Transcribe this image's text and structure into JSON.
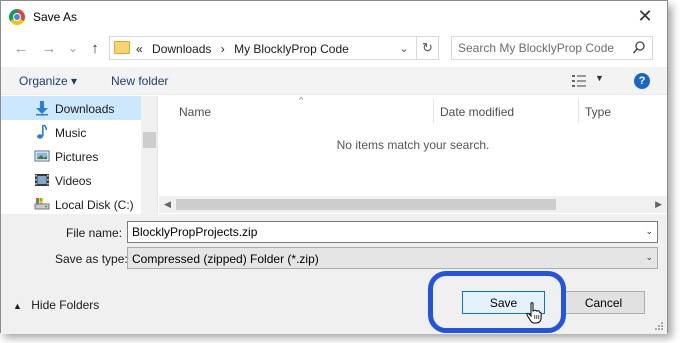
{
  "window": {
    "title": "Save As",
    "close_glyph": "✕"
  },
  "nav": {
    "back_glyph": "←",
    "forward_glyph": "→",
    "history_glyph": "⌄",
    "up_glyph": "↑",
    "breadcrumb": [
      "«",
      "Downloads",
      "›",
      "My BlocklyProp Code"
    ],
    "dropdown_glyph": "⌄",
    "refresh_glyph": "↻",
    "search_placeholder": "Search My BlocklyProp Code"
  },
  "toolbar": {
    "organize_label": "Organize ▾",
    "new_folder_label": "New folder",
    "view_dd_glyph": "▼",
    "help_glyph": "?"
  },
  "sidebar": {
    "items": [
      {
        "label": "Downloads",
        "icon": "download-arrow-icon",
        "selected": true
      },
      {
        "label": "Music",
        "icon": "music-note-icon",
        "selected": false
      },
      {
        "label": "Pictures",
        "icon": "pictures-icon",
        "selected": false
      },
      {
        "label": "Videos",
        "icon": "videos-icon",
        "selected": false
      },
      {
        "label": "Local Disk (C:)",
        "icon": "local-disk-icon",
        "selected": false
      }
    ]
  },
  "filelist": {
    "columns": [
      "Name",
      "Date modified",
      "Type"
    ],
    "sort_glyph": "^",
    "empty_message": "No items match your search.",
    "scroll_left_glyph": "◀",
    "scroll_right_glyph": "▶"
  },
  "form": {
    "filename_label": "File name:",
    "filename_value": "BlocklyPropProjects.zip",
    "savetype_label": "Save as type:",
    "savetype_value": "Compressed (zipped) Folder (*.zip)",
    "dropdown_glyph": "⌄"
  },
  "footer": {
    "hide_folders_caret": "▲",
    "hide_folders_label": "Hide Folders",
    "save_label": "Save",
    "cancel_label": "Cancel"
  },
  "colors": {
    "accent": "#0078d7",
    "highlight_ring": "#2254e0",
    "selection": "#cce8ff"
  }
}
